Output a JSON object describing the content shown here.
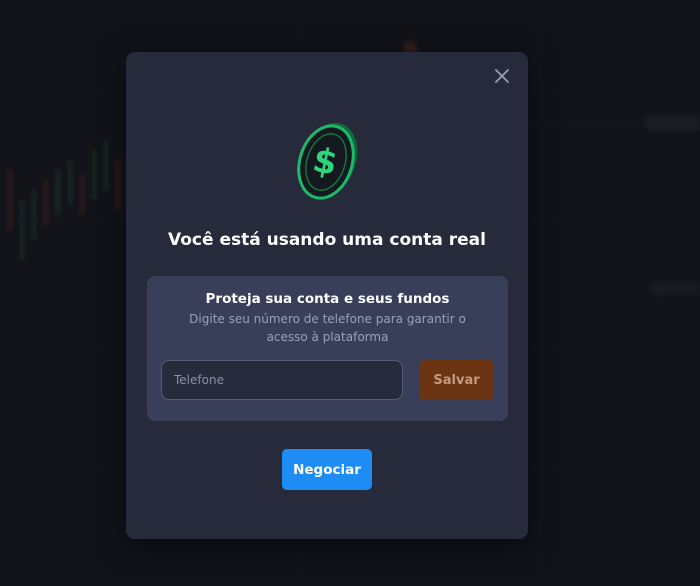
{
  "modal": {
    "title": "Você está usando uma conta real",
    "close_icon": "close-icon",
    "coin_icon": "dollar-coin-icon",
    "protect": {
      "title": "Proteja sua conta e seus fundos",
      "description": "Digite seu número de telefone para garantir o acesso à plataforma",
      "phone_placeholder": "Telefone",
      "phone_value": "",
      "save_label": "Salvar"
    },
    "trade_label": "Negociar"
  },
  "colors": {
    "modal_bg": "#262a3b",
    "card_bg": "#3a3f59",
    "save_button": "#6b3514",
    "trade_button": "#1e8cf5",
    "coin_green": "#1fb86a"
  }
}
